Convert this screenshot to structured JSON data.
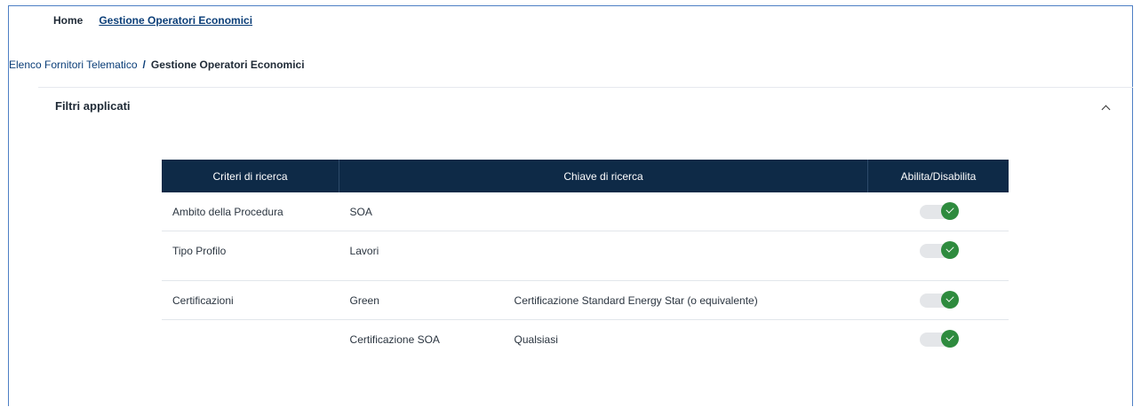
{
  "nav": {
    "items": [
      {
        "label": "Home",
        "active": false
      },
      {
        "label": "Gestione Operatori Economici",
        "active": true
      }
    ]
  },
  "breadcrumb": {
    "parent": "Elenco Fornitori Telematico",
    "separator": "/",
    "current": "Gestione Operatori Economici"
  },
  "filters": {
    "title": "Filtri applicati",
    "collapse_icon": "chevron-up-icon",
    "columns": [
      "Criteri di ricerca",
      "Chiave di ricerca",
      "Abilita/Disabilita"
    ],
    "rows": [
      {
        "criterio": "Ambito della Procedura",
        "chiave": "SOA",
        "valore": "",
        "enabled": true
      },
      {
        "criterio": "Tipo Profilo",
        "chiave": "Lavori",
        "valore": "",
        "enabled": true
      },
      {
        "criterio": "Certificazioni",
        "chiave": "Green",
        "valore": "Certificazione Standard Energy Star (o equivalente)",
        "enabled": true
      },
      {
        "criterio": "",
        "chiave": "Certificazione SOA",
        "valore": "Qualsiasi",
        "enabled": true
      }
    ]
  },
  "colors": {
    "header_bg": "#0e2a47",
    "toggle_on": "#2e8b3e",
    "link": "#0b3e78"
  }
}
